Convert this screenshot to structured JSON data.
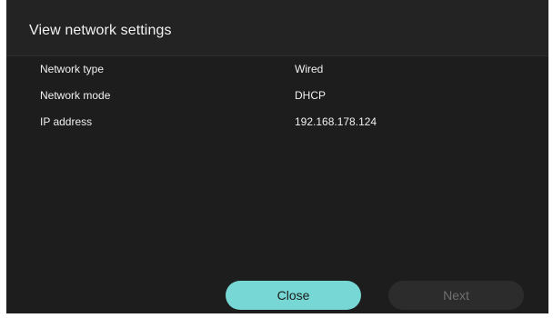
{
  "dialog": {
    "title": "View network settings",
    "rows": [
      {
        "label": "Network type",
        "value": "Wired"
      },
      {
        "label": "Network mode",
        "value": "DHCP"
      },
      {
        "label": "IP address",
        "value": "192.168.178.124"
      }
    ]
  },
  "buttons": {
    "close_label": "Close",
    "next_label": "Next",
    "close_color": "#76d7d4",
    "next_state": "disabled"
  },
  "theme": {
    "background": "#1d1d1d",
    "header_background": "#232323",
    "accent": "#76d7d4"
  }
}
